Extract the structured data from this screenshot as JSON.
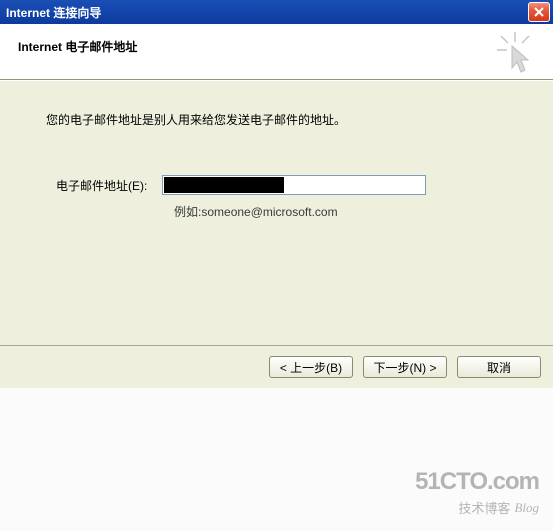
{
  "titlebar": {
    "title": "Internet 连接向导"
  },
  "header": {
    "title": "Internet 电子邮件地址"
  },
  "content": {
    "description": "您的电子邮件地址是别人用来给您发送电子邮件的地址。",
    "field_label": "电子邮件地址(E):",
    "email_value": "",
    "example_prefix": "例如:",
    "example_value": "someone@microsoft.com"
  },
  "buttons": {
    "back": "< 上一步(B)",
    "next": "下一步(N) >",
    "cancel": "取消"
  },
  "watermark": {
    "main": "51CTO.com",
    "sub_cn": "技术博客",
    "sub_en": "Blog"
  }
}
